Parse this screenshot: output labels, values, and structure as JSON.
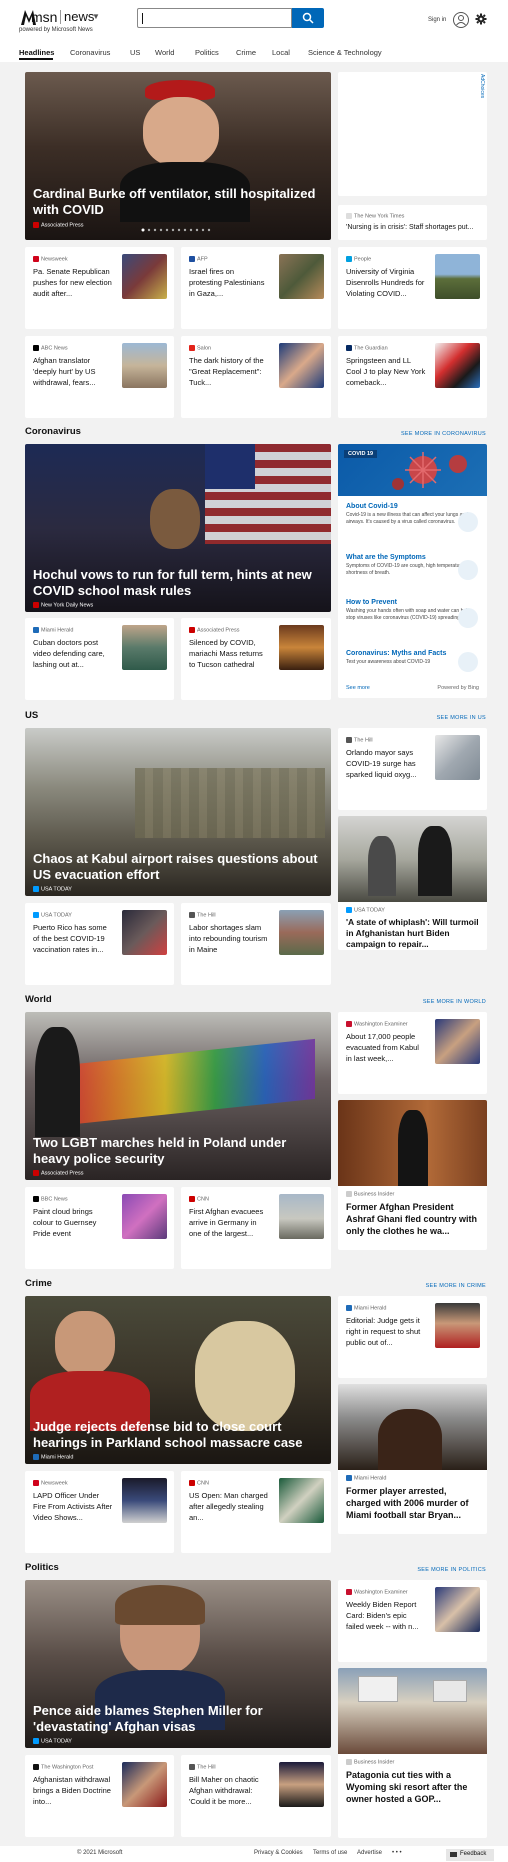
{
  "header": {
    "brand_msn": "msn",
    "brand_news": "news",
    "powered_by": "powered by Microsoft News",
    "search": {
      "value": "",
      "placeholder": ""
    },
    "sign_in": "Sign in"
  },
  "nav": {
    "items": [
      "Headlines",
      "Coronavirus",
      "US",
      "World",
      "Politics",
      "Crime",
      "Local",
      "Science & Technology"
    ]
  },
  "ad_choices": "AdChoices",
  "headlines": {
    "hero": {
      "title": "Cardinal Burke off ventilator, still hospitalized with COVID",
      "source": "Associated Press"
    },
    "right_top": {
      "source": "The New York Times",
      "title": "'Nursing is in crisis': Staff shortages put..."
    },
    "cards": [
      {
        "source": "Newsweek",
        "title": "Pa. Senate Republican pushes for new election audit after..."
      },
      {
        "source": "AFP",
        "title": "Israel fires on protesting Palestinians in Gaza,..."
      },
      {
        "source": "People",
        "title": "University of Virginia Disenrolls Hundreds for Violating COVID..."
      },
      {
        "source": "ABC News",
        "title": "Afghan translator 'deeply hurt' by US withdrawal, fears..."
      },
      {
        "source": "Salon",
        "title": "The dark history of the \"Great Replacement\": Tuck..."
      },
      {
        "source": "The Guardian",
        "title": "Springsteen and LL Cool J to play New York comeback..."
      }
    ]
  },
  "coronavirus": {
    "label": "Coronavirus",
    "see_more": "SEE MORE IN CORONAVIRUS",
    "hero": {
      "title": "Hochul vows to run for full term, hints at new COVID school mask rules",
      "source": "New York Daily News"
    },
    "cards": [
      {
        "source": "Miami Herald",
        "title": "Cuban doctors post video defending care, lashing out at..."
      },
      {
        "source": "Associated Press",
        "title": "Silenced by COVID, mariachi Mass returns to Tucson cathedral"
      }
    ],
    "info": {
      "badge": "COVID 19",
      "items": [
        {
          "title": "About Covid-19",
          "desc": "Covid-19 is a new illness that can affect your lungs and airways. It's caused by a virus called coronavirus."
        },
        {
          "title": "What are the Symptoms",
          "desc": "Symptoms of COVID-19 are cough, high temperature and shortness of breath."
        },
        {
          "title": "How to Prevent",
          "desc": "Washing your hands often with soap and water can help stop viruses like coronavirus (COVID-19) spreading."
        },
        {
          "title": "Coronavirus: Myths and Facts",
          "desc": "Test your awareness about COVID-19"
        }
      ],
      "see_more": "See more",
      "powered": "Powered by Bing"
    }
  },
  "us": {
    "label": "US",
    "see_more": "SEE MORE IN US",
    "hero": {
      "title": "Chaos at Kabul airport raises questions about US evacuation effort",
      "source": "USA TODAY"
    },
    "right_top": {
      "source": "The Hill",
      "title": "Orlando mayor says COVID-19 surge has sparked liquid oxyg..."
    },
    "right_big": {
      "source": "USA TODAY",
      "title": "'A state of whiplash': Will turmoil in Afghanistan hurt Biden campaign to repair..."
    },
    "cards": [
      {
        "source": "USA TODAY",
        "title": "Puerto Rico has some of the best COVID-19 vaccination rates in..."
      },
      {
        "source": "The Hill",
        "title": "Labor shortages slam into rebounding tourism in Maine"
      }
    ]
  },
  "world": {
    "label": "World",
    "see_more": "SEE MORE IN WORLD",
    "hero": {
      "title": "Two LGBT marches held in Poland under heavy police security",
      "source": "Associated Press"
    },
    "right_top": {
      "source": "Washington Examiner",
      "title": "About 17,000 people evacuated from Kabul in last week,..."
    },
    "right_big": {
      "source": "Business Insider",
      "title": "Former Afghan President Ashraf Ghani fled country with only the clothes he wa..."
    },
    "cards": [
      {
        "source": "BBC News",
        "title": "Paint cloud brings colour to Guernsey Pride event"
      },
      {
        "source": "CNN",
        "title": "First Afghan evacuees arrive in Germany in one of the largest..."
      }
    ]
  },
  "crime": {
    "label": "Crime",
    "see_more": "SEE MORE IN CRIME",
    "hero": {
      "title": "Judge rejects defense bid to close court hearings in Parkland school massacre case",
      "source": "Miami Herald"
    },
    "right_top": {
      "source": "Miami Herald",
      "title": "Editorial: Judge gets it right in request to shut public out of..."
    },
    "right_big": {
      "source": "Miami Herald",
      "title": "Former player arrested, charged with 2006 murder of Miami football star Bryan..."
    },
    "cards": [
      {
        "source": "Newsweek",
        "title": "LAPD Officer Under Fire From Activists After Video Shows..."
      },
      {
        "source": "CNN",
        "title": "US Open: Man charged after allegedly stealing an..."
      }
    ]
  },
  "politics": {
    "label": "Politics",
    "see_more": "SEE MORE IN POLITICS",
    "hero": {
      "title": "Pence aide blames Stephen Miller for 'devastating' Afghan visas",
      "source": "USA TODAY"
    },
    "right_top": {
      "source": "Washington Examiner",
      "title": "Weekly Biden Report Card: Biden's epic failed week -- with n..."
    },
    "right_big": {
      "source": "Business Insider",
      "title": "Patagonia cut ties with a Wyoming ski resort after the owner hosted a GOP..."
    },
    "cards": [
      {
        "source": "The Washington Post",
        "title": "Afghanistan withdrawal brings a Biden Doctrine into..."
      },
      {
        "source": "The Hill",
        "title": "Bill Maher on chaotic Afghan withdrawal: 'Could it be more..."
      }
    ]
  },
  "footer": {
    "copyright": "© 2021 Microsoft",
    "links": [
      "Privacy & Cookies",
      "Terms of use",
      "Advertise"
    ],
    "more": "• • •",
    "feedback": "Feedback"
  },
  "colors": {
    "accent": "#0067b8",
    "covid_bg": "#1c6fb5",
    "page_bg": "#f2f2f2"
  }
}
